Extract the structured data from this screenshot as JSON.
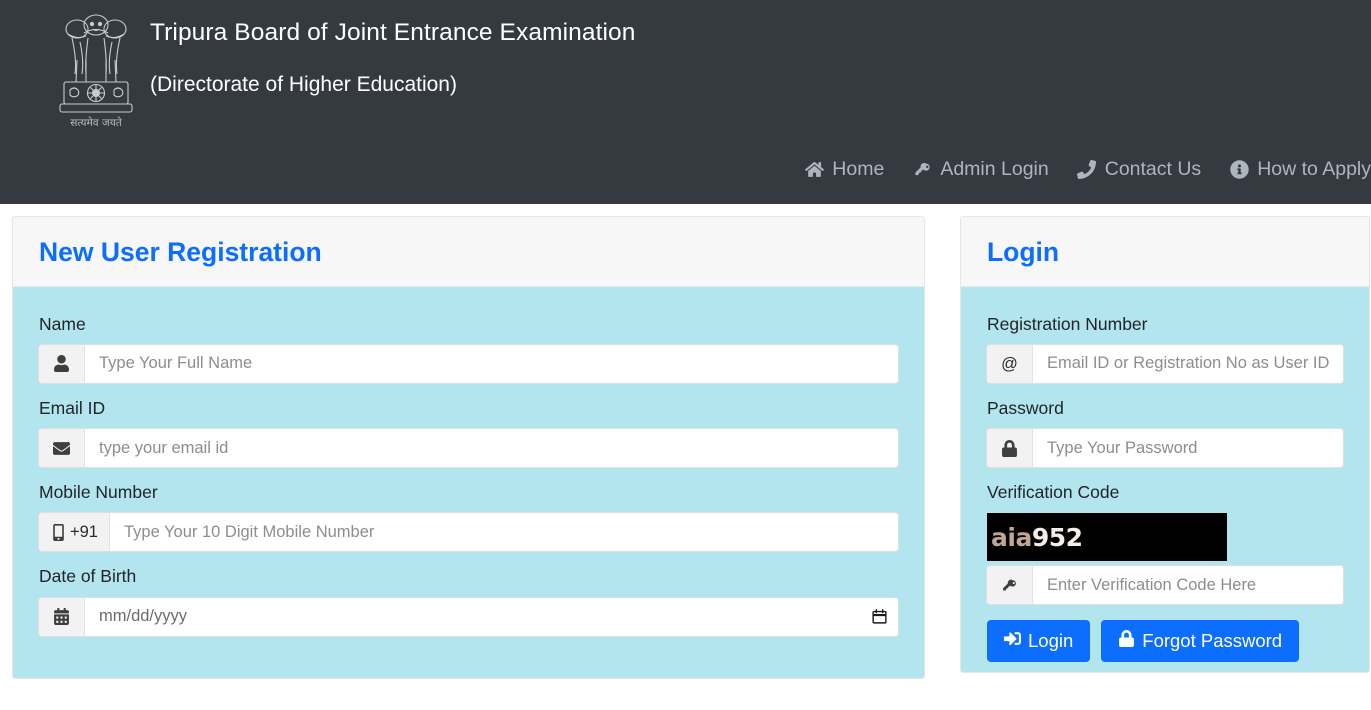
{
  "header": {
    "emblem_alt": "national-emblem-of-india",
    "emblem_motto": "सत्यमेव जयते",
    "title": "Tripura Board of Joint Entrance Examination",
    "subtitle": "(Directorate of Higher Education)",
    "background_color": "#343a40",
    "nav": [
      {
        "label": "Home",
        "icon": "home-icon"
      },
      {
        "label": "Admin Login",
        "icon": "key-icon"
      },
      {
        "label": "Contact Us",
        "icon": "phone-icon"
      },
      {
        "label": "How to Apply",
        "icon": "info-circle-icon"
      }
    ]
  },
  "registration": {
    "title": "New User Registration",
    "title_color": "#0d6efd",
    "body_color": "#b3e5ef",
    "fields": [
      {
        "label": "Name",
        "icon": "user-icon",
        "addon_text": "",
        "placeholder": "Type Your Full Name",
        "value": ""
      },
      {
        "label": "Email ID",
        "icon": "envelope-icon",
        "addon_text": "",
        "placeholder": "type your email id",
        "value": ""
      },
      {
        "label": "Mobile Number",
        "icon": "mobile-icon",
        "addon_text": "+91",
        "placeholder": "Type Your 10 Digit Mobile Number",
        "value": ""
      },
      {
        "label": "Date of Birth",
        "icon": "calendar-icon",
        "addon_text": "",
        "placeholder": "mm/dd/yyyy",
        "value": ""
      }
    ]
  },
  "login": {
    "title": "Login",
    "title_color": "#0d6efd",
    "body_color": "#b3e5ef",
    "registration_number_label": "Registration Number",
    "registration_number_addon": "@",
    "registration_number_placeholder": "Email ID or Registration No as User ID",
    "registration_number_value": "",
    "password_label": "Password",
    "password_icon": "lock-icon",
    "password_placeholder": "Type Your Password",
    "password_value": "",
    "verification_label": "Verification Code",
    "captcha_text_part1": "aia",
    "captcha_text_part2": "952",
    "captcha_full": "aia952",
    "captcha_bg": "#000000",
    "verification_icon": "key-icon",
    "verification_placeholder": "Enter Verification Code Here",
    "verification_value": "",
    "buttons": [
      {
        "label": "Login",
        "icon": "sign-in-icon",
        "color": "#0d6efd"
      },
      {
        "label": "Forgot Password",
        "icon": "lock-icon",
        "color": "#0d6efd"
      }
    ]
  }
}
